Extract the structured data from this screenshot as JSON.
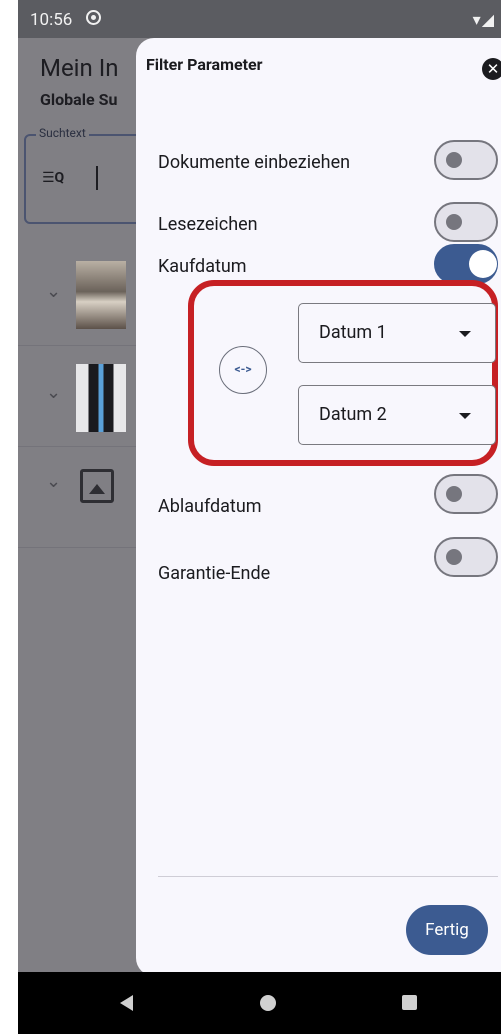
{
  "status_bar": {
    "time": "10:56",
    "icons": "▾◢"
  },
  "background_app": {
    "title": "Mein In",
    "subtitle": "Globale Su",
    "search_label": "Suchtext",
    "search_icon_glyph": "☰Q"
  },
  "dialog": {
    "title": "Filter Parameter",
    "close_glyph": "✕",
    "filters": [
      {
        "label": "Dokumente einbeziehen",
        "enabled": false
      },
      {
        "label": "Lesezeichen",
        "enabled": false
      },
      {
        "label": "Kaufdatum",
        "enabled": true
      },
      {
        "label": "Ablaufdatum",
        "enabled": false
      },
      {
        "label": "Garantie-Ende",
        "enabled": false
      }
    ],
    "date_range": {
      "swap_label": "<->",
      "date1": "Datum 1",
      "date2": "Datum 2",
      "highlight_color": "#c62024"
    },
    "done_label": "Fertig"
  },
  "colors": {
    "accent": "#3c5b91"
  }
}
